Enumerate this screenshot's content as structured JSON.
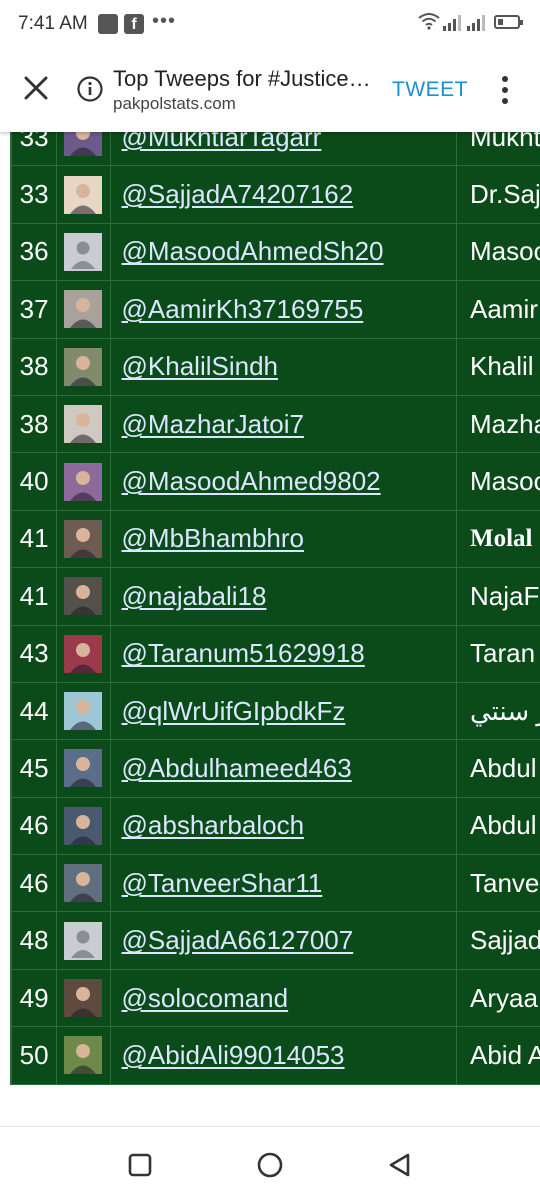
{
  "status_bar": {
    "time": "7:41 AM",
    "fb_glyph": "f",
    "dots": "•••",
    "icons": [
      "gallery-icon",
      "facebook-icon",
      "more-notifications-icon",
      "wifi-icon",
      "signal-icon",
      "signal-icon",
      "battery-icon"
    ],
    "battery_level": 0.3
  },
  "toolbar": {
    "close_icon": "close-icon",
    "info_icon": "info-icon",
    "title": "Top Tweeps for #JusticeForSajjad",
    "domain": "pakpolstats.com",
    "tweet_label": "TWEET",
    "more_icon": "more-vert-icon",
    "accent_color": "#1a8fd6"
  },
  "table": {
    "background": "#0b4a19",
    "rows": [
      {
        "rank": "33",
        "handle": "@MukhtiarTagarr",
        "name": "Mukhtiar"
      },
      {
        "rank": "33",
        "handle": "@SajjadA74207162",
        "name": "Dr.Sajjad"
      },
      {
        "rank": "36",
        "handle": "@MasoodAhmedSh20",
        "name": "Masood"
      },
      {
        "rank": "37",
        "handle": "@AamirKh37169755",
        "name": "Aamir"
      },
      {
        "rank": "38",
        "handle": "@KhalilSindh",
        "name": "Khalil"
      },
      {
        "rank": "38",
        "handle": "@MazharJatoi7",
        "name": "Mazhar"
      },
      {
        "rank": "40",
        "handle": "@MasoodAhmed9802",
        "name": "Masood"
      },
      {
        "rank": "41",
        "handle": "@MbBhambhro",
        "name": "Molal"
      },
      {
        "rank": "41",
        "handle": "@najabali18",
        "name": "NajaF"
      },
      {
        "rank": "43",
        "handle": "@Taranum51629918",
        "name": "Taran"
      },
      {
        "rank": "44",
        "handle": "@qlWrUifGIpbdkFz",
        "name": "ر سنتي"
      },
      {
        "rank": "45",
        "handle": "@Abdulhameed463",
        "name": "Abdul"
      },
      {
        "rank": "46",
        "handle": "@absharbaloch",
        "name": "Abdul"
      },
      {
        "rank": "46",
        "handle": "@TanveerShar11",
        "name": "Tanve"
      },
      {
        "rank": "48",
        "handle": "@SajjadA66127007",
        "name": "Sajjad"
      },
      {
        "rank": "49",
        "handle": "@solocomand",
        "name": "Aryaa"
      },
      {
        "rank": "50",
        "handle": "@AbidAli99014053",
        "name": "Abid A"
      }
    ]
  },
  "nav_bar": {
    "recents_icon": "recents-square-icon",
    "home_icon": "home-circle-icon",
    "back_icon": "back-triangle-icon"
  }
}
